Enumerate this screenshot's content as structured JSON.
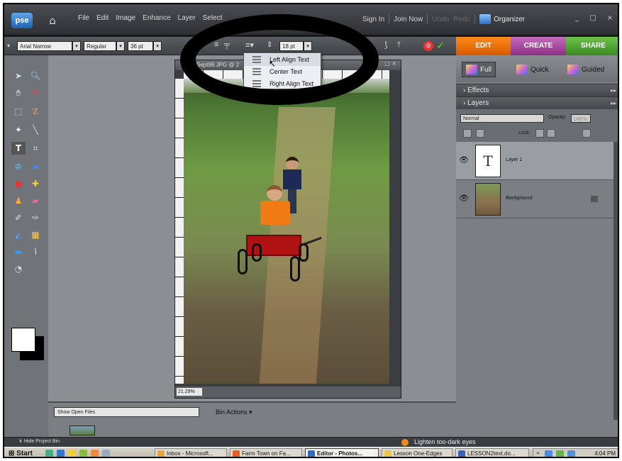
{
  "app": {
    "logo": "pse",
    "menu": [
      "File",
      "Edit",
      "Image",
      "Enhance",
      "Layer",
      "Select"
    ],
    "sign_in": "Sign In",
    "join_now": "Join Now",
    "undo": "Undo",
    "redo": "Redo",
    "organizer": "Organizer",
    "window_controls": "_ □ ×"
  },
  "options": {
    "font_family": "Arial Narrow",
    "font_style": "Regular",
    "font_size": "36 pt",
    "leading": "18 pt"
  },
  "align_menu": {
    "items": [
      "Left Align Text",
      "Center Text",
      "Right Align Text"
    ],
    "highlighted": "Left Align Text"
  },
  "document": {
    "title": "Sept98.JPG @ 2",
    "zoom": "21.29%"
  },
  "panel": {
    "tabs": [
      "EDIT",
      "CREATE",
      "SHARE"
    ],
    "modes": [
      "Full",
      "Quick",
      "Guided"
    ],
    "sections": [
      "Effects",
      "Layers"
    ],
    "blend_mode": "Normal",
    "opacity_label": "Opacity:",
    "opacity_value": "100%",
    "lock_label": "Lock:",
    "layers": [
      {
        "name": "Layer 1",
        "thumb": "T"
      },
      {
        "name": "Background"
      }
    ]
  },
  "bin": {
    "selector": "Show Open Files",
    "actions": "Bin Actions ▾",
    "hide": "Hide Project Bin"
  },
  "status": {
    "tip": "Lighten too-dark eyes"
  },
  "taskbar": {
    "start": "Start",
    "tasks": [
      "Inbox - Microsoft...",
      "Farm Town on Fa...",
      "Editor - Photos...",
      "Lesson One-Edges",
      "LESSON2text.do..."
    ],
    "clock": "4:04 PM"
  },
  "colors": {
    "edit_tab": "#e8700a",
    "create_tab": "#a8489f",
    "share_tab": "#4fa52f",
    "panel_bg": "#7b7e82",
    "titlebar_bg": "#3a3d41"
  }
}
